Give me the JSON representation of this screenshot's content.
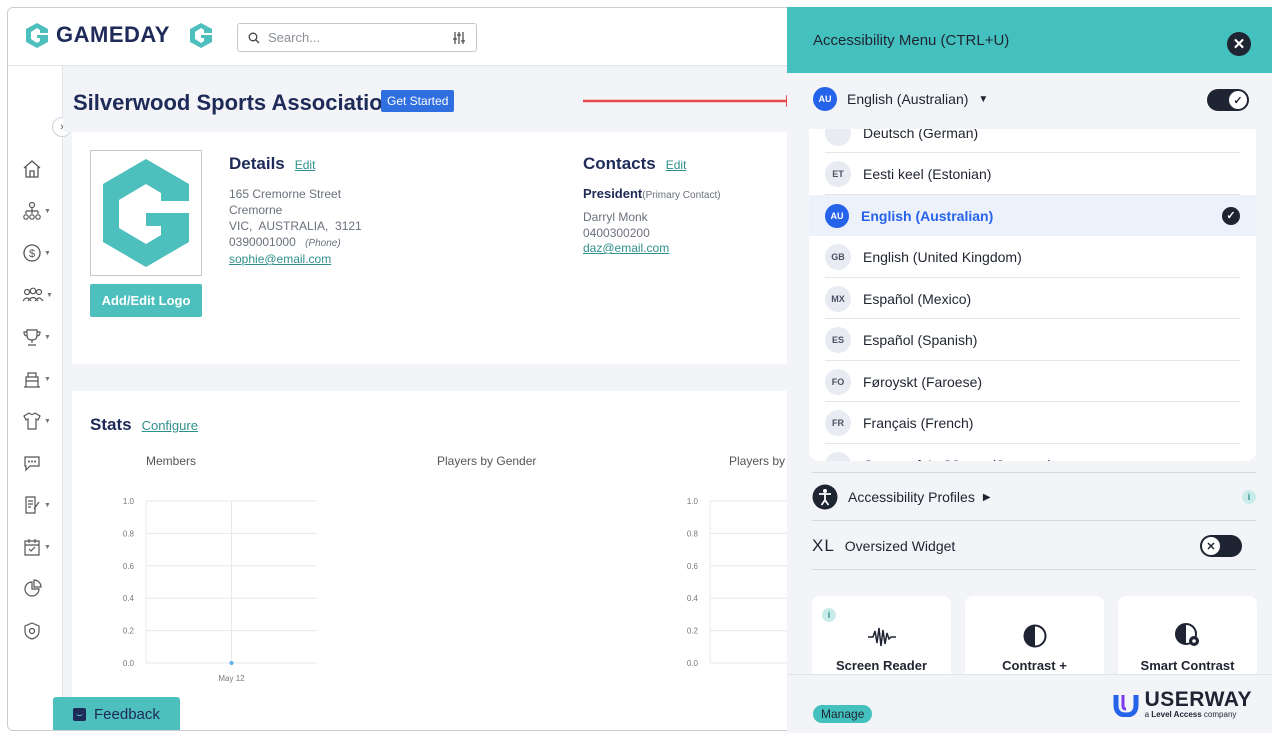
{
  "app": {
    "brand": "GAMEDAY",
    "search_placeholder": "Search...",
    "org_title": "Silverwood Sports Association",
    "get_started": "Get Started",
    "feedback": "Feedback"
  },
  "details": {
    "heading": "Details",
    "edit": "Edit",
    "line1": "165 Cremorne Street",
    "line2": "Cremorne",
    "line3": "VIC,  AUSTRALIA,  3121",
    "phone": "0390001000",
    "phone_label": "(Phone)",
    "email": "sophie@email.com",
    "logo_button": "Add/Edit Logo"
  },
  "contacts": {
    "heading": "Contacts",
    "edit": "Edit",
    "role": "President",
    "role_note": "(Primary Contact)",
    "name": "Darryl Monk",
    "phone": "0400300200",
    "email": "daz@email.com"
  },
  "stats": {
    "heading": "Stats",
    "configure": "Configure",
    "chart1_title": "Members",
    "chart2_title": "Players by Gender",
    "chart3_title": "Players by Ge"
  },
  "chart_data": [
    {
      "type": "line",
      "title": "Members",
      "categories": [
        "May 12"
      ],
      "series": [
        {
          "values": [
            0
          ]
        }
      ],
      "ylim": [
        0,
        1.0
      ],
      "yticks": [
        "1.0",
        "0.8",
        "0.6",
        "0.4",
        "0.2",
        "0.0"
      ],
      "grid": true
    },
    {
      "type": "line",
      "title": "Players by Ge",
      "categories": [],
      "series": [],
      "ylim": [
        0,
        1.0
      ],
      "yticks": [
        "1.0",
        "0.8",
        "0.6",
        "0.4",
        "0.2",
        "0.0"
      ],
      "grid": true
    }
  ],
  "panel": {
    "title": "Accessibility Menu (CTRL+U)",
    "current_code": "AU",
    "current_lang": "English (Australian)",
    "languages": [
      {
        "code": "",
        "name": "Deutsch (German)"
      },
      {
        "code": "ET",
        "name": "Eesti keel (Estonian)"
      },
      {
        "code": "AU",
        "name": "English (Australian)"
      },
      {
        "code": "GB",
        "name": "English (United Kingdom)"
      },
      {
        "code": "MX",
        "name": "Español (Mexico)"
      },
      {
        "code": "ES",
        "name": "Español (Spanish)"
      },
      {
        "code": "FO",
        "name": "Føroyskt (Faroese)"
      },
      {
        "code": "FR",
        "name": "Français (French)"
      },
      {
        "code": "SM",
        "name": "Gagana fa'a Sāmoa (Samoan)"
      }
    ],
    "profiles": "Accessibility Profiles",
    "xl": "XL",
    "oversized": "Oversized Widget",
    "tiles": [
      "Screen Reader",
      "Contrast +",
      "Smart Contrast"
    ],
    "info": "i",
    "manage": "Manage",
    "userway": "USERWAY",
    "userway_sub_prefix": "a ",
    "userway_sub_brand": "Level Access",
    "userway_sub_suffix": " company"
  },
  "colors": {
    "accent": "#44c1bf",
    "navy": "#1e2a57",
    "blue": "#2563eb",
    "arrow": "#e5484d"
  }
}
